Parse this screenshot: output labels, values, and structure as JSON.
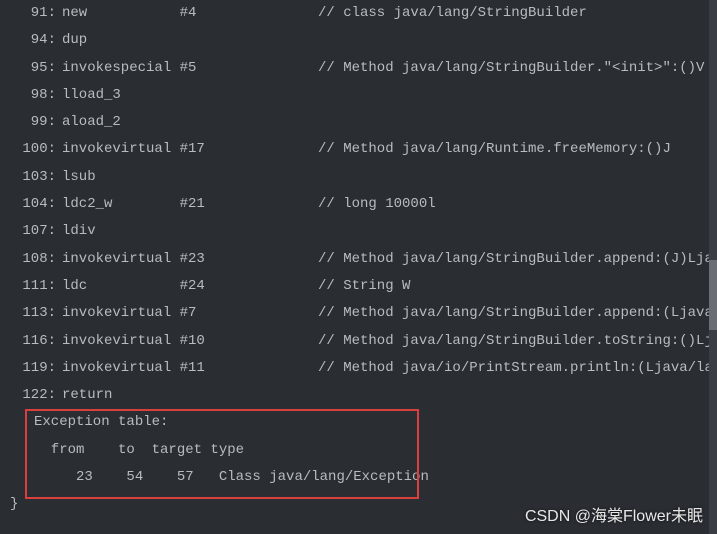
{
  "lines": [
    {
      "addr": "91:",
      "op": "new           #4",
      "comment": "// class java/lang/StringBuilder"
    },
    {
      "addr": "94:",
      "op": "dup",
      "comment": ""
    },
    {
      "addr": "95:",
      "op": "invokespecial #5",
      "comment": "// Method java/lang/StringBuilder.\"<init>\":()V"
    },
    {
      "addr": "98:",
      "op": "lload_3",
      "comment": ""
    },
    {
      "addr": "99:",
      "op": "aload_2",
      "comment": ""
    },
    {
      "addr": "100:",
      "op": "invokevirtual #17",
      "comment": "// Method java/lang/Runtime.freeMemory:()J"
    },
    {
      "addr": "103:",
      "op": "lsub",
      "comment": ""
    },
    {
      "addr": "104:",
      "op": "ldc2_w        #21",
      "comment": "// long 10000l"
    },
    {
      "addr": "107:",
      "op": "ldiv",
      "comment": ""
    },
    {
      "addr": "108:",
      "op": "invokevirtual #23",
      "comment": "// Method java/lang/StringBuilder.append:(J)Ljava/la"
    },
    {
      "addr": "111:",
      "op": "ldc           #24",
      "comment": "// String W"
    },
    {
      "addr": "113:",
      "op": "invokevirtual #7",
      "comment": "// Method java/lang/StringBuilder.append:(Ljava/lang"
    },
    {
      "addr": "116:",
      "op": "invokevirtual #10",
      "comment": "// Method java/lang/StringBuilder.toString:()Ljava/la"
    },
    {
      "addr": "119:",
      "op": "invokevirtual #11",
      "comment": "// Method java/io/PrintStream.println:(Ljava/lang/Str"
    },
    {
      "addr": "122:",
      "op": "return",
      "comment": ""
    }
  ],
  "exception_table": {
    "header": "Exception table:",
    "col_header": "  from    to  target type",
    "row": "     23    54    57   Class java/lang/Exception"
  },
  "close_brace": "}",
  "watermark": "CSDN @海棠Flower未眠"
}
